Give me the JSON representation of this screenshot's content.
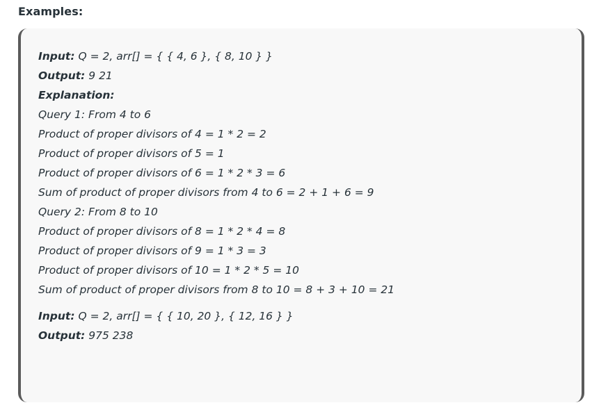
{
  "heading": "Examples:",
  "example1": {
    "input_label": "Input:",
    "input_value": " Q = 2, arr[] = { { 4, 6 }, { 8, 10 } }",
    "output_label": "Output:",
    "output_value": " 9 21",
    "explanation_label": "Explanation:",
    "explanation_lines": [
      "Query 1: From 4 to 6",
      "Product of proper divisors of 4 = 1 * 2 = 2",
      "Product of proper divisors of 5 = 1",
      "Product of proper divisors of 6 = 1 * 2 * 3 = 6",
      "Sum of product of proper divisors from 4 to 6 = 2 + 1 + 6 = 9",
      "Query 2: From 8 to 10",
      "Product of proper divisors of 8 = 1 * 2 * 4 = 8",
      "Product of proper divisors of 9 = 1 * 3 = 3",
      "Product of proper divisors of 10 = 1 * 2 * 5 = 10",
      "Sum of product of proper divisors from 8 to 10 = 8 + 3 + 10 = 21"
    ]
  },
  "example2": {
    "input_label": "Input:",
    "input_value": " Q = 2, arr[] = { { 10, 20 }, { 12, 16 } }",
    "output_label": "Output:",
    "output_value": " 975 238"
  }
}
